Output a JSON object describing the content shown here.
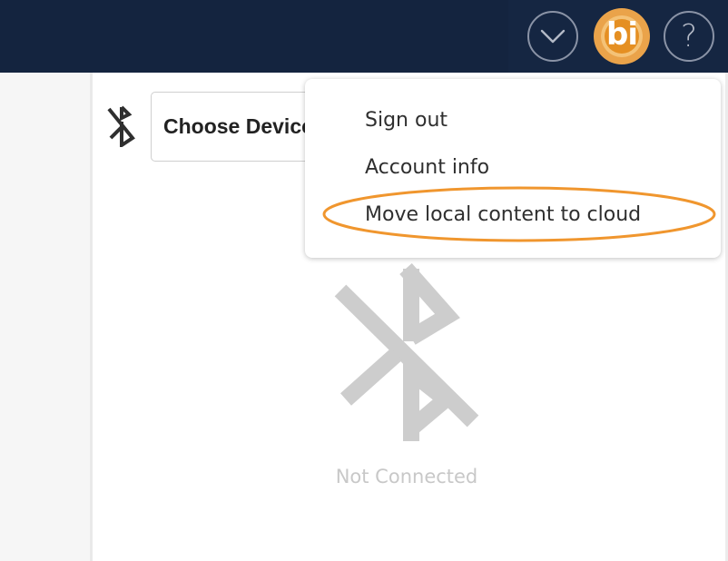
{
  "header": {
    "chevron_icon": "chevron-down-icon",
    "avatar_text": "bi",
    "help_icon": "?"
  },
  "device": {
    "bluetooth_icon": "bluetooth-disabled-icon",
    "select_label": "Choose Device"
  },
  "account_menu": {
    "items": [
      {
        "label": "Sign out"
      },
      {
        "label": "Account info"
      },
      {
        "label": "Move local content to cloud"
      }
    ],
    "highlight_color": "#f0962e"
  },
  "status": {
    "icon": "bluetooth-disabled-icon",
    "text": "Not Connected"
  },
  "colors": {
    "topbar": "#14243f",
    "avatar": "#e58f22",
    "status_gray": "#c8c8c8"
  }
}
